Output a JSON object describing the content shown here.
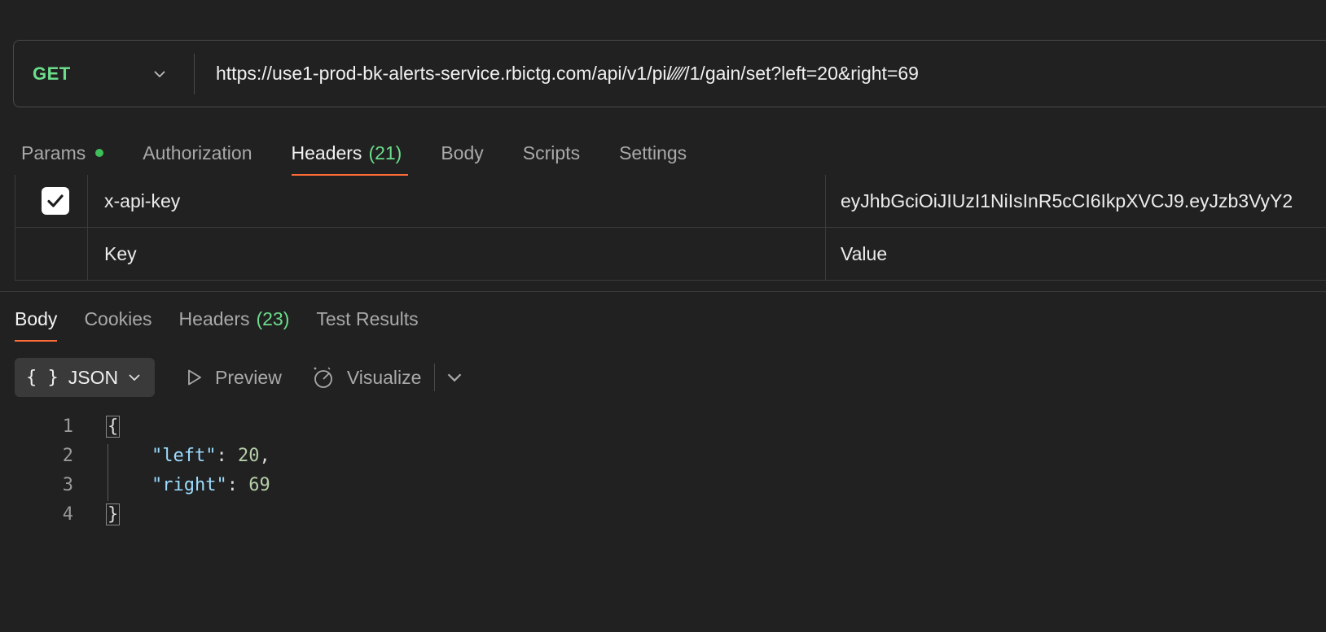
{
  "request": {
    "method": "GET",
    "url": "https://use1-prod-bk-alerts-service.rbictg.com/api/v1/pi/⁄⁄⁄⁄/1/gain/set?left=20&right=69"
  },
  "request_tabs": [
    {
      "label": "Params",
      "has_dot": true
    },
    {
      "label": "Authorization"
    },
    {
      "label": "Headers",
      "count": "(21)",
      "active": true
    },
    {
      "label": "Body"
    },
    {
      "label": "Scripts"
    },
    {
      "label": "Settings"
    }
  ],
  "headers_table": {
    "rows": [
      {
        "checked": true,
        "key": "x-api-key",
        "value": "eyJhbGciOiJIUzI1NiIsInR5cCI6IkpXVCJ9.eyJzb3VyY2"
      }
    ],
    "key_placeholder": "Key",
    "value_placeholder": "Value"
  },
  "response_tabs": [
    {
      "label": "Body",
      "active": true
    },
    {
      "label": "Cookies"
    },
    {
      "label": "Headers",
      "count": "(23)"
    },
    {
      "label": "Test Results"
    }
  ],
  "toolbar": {
    "format_label": "JSON",
    "format_icon": "{ }",
    "preview_label": "Preview",
    "visualize_label": "Visualize"
  },
  "code": {
    "line_numbers": [
      "1",
      "2",
      "3",
      "4"
    ],
    "open_brace": "{",
    "close_brace": "}",
    "entries": [
      {
        "key": "\"left\"",
        "value": "20",
        "trailing": ","
      },
      {
        "key": "\"right\"",
        "value": "69",
        "trailing": ""
      }
    ]
  },
  "colors": {
    "background": "#212121",
    "method_green": "#6bdd8b",
    "accent_orange": "#ff6c37",
    "json_key": "#9cdcfe",
    "json_number": "#b5cea8"
  }
}
